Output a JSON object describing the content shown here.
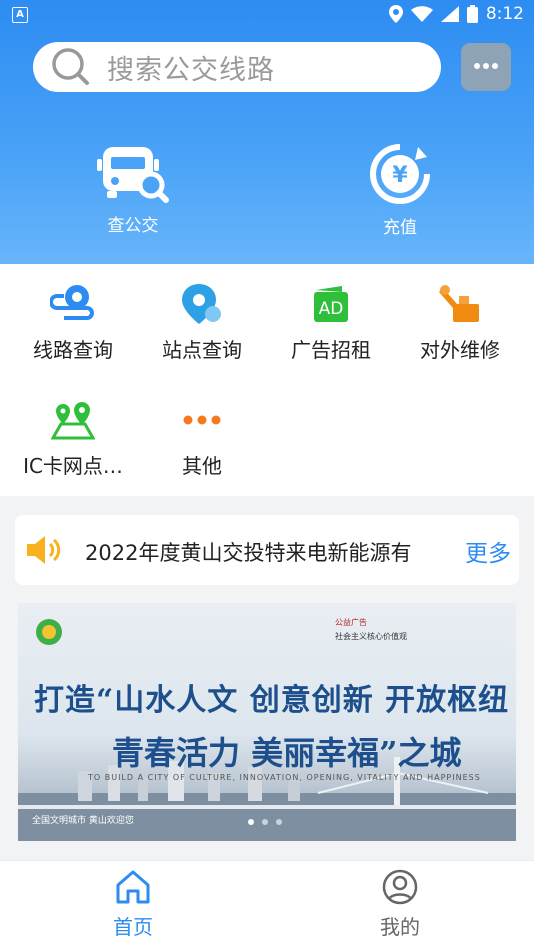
{
  "status_bar": {
    "sim_label": "A",
    "time": "8:12",
    "icons": [
      "location-icon",
      "wifi-icon",
      "signal-icon",
      "battery-icon"
    ]
  },
  "search": {
    "placeholder": "搜索公交线路",
    "icon": "search-icon"
  },
  "header_actions": {
    "message_icon": "chat-bubble-icon"
  },
  "quick_actions": [
    {
      "label": "查公交",
      "icon": "bus-search-icon"
    },
    {
      "label": "充值",
      "icon": "recharge-yen-icon"
    }
  ],
  "services": [
    {
      "label": "线路查询",
      "icon": "route-icon",
      "color": "#2d8cf2"
    },
    {
      "label": "站点查询",
      "icon": "station-pin-icon",
      "color": "#2da0e6"
    },
    {
      "label": "广告招租",
      "icon": "ad-icon",
      "color": "#2fbf3a"
    },
    {
      "label": "对外维修",
      "icon": "repair-icon",
      "color": "#f08a10"
    },
    {
      "label": "IC卡网点…",
      "icon": "map-pins-icon",
      "color": "#2fbf3a"
    },
    {
      "label": "其他",
      "icon": "more-dots-icon",
      "color": "#f57a1f"
    }
  ],
  "notice": {
    "icon": "speaker-icon",
    "text": "2022年度黄山交投特来电新能源有",
    "more_label": "更多"
  },
  "banner": {
    "line1": "打造“山水人文 创意创新 开放枢纽",
    "line2": "青春活力 美丽幸福”之城",
    "subtitle": "TO BUILD A CITY OF CULTURE, INNOVATION, OPENING, VITALITY AND HAPPINESS",
    "footer": "全国文明城市 黄山欢迎您",
    "side_text": "公益广告",
    "side_text2": "社会主义核心价值观",
    "page_count": 3,
    "active_page": 1
  },
  "tab_bar": {
    "tabs": [
      {
        "label": "首页",
        "icon": "home-icon",
        "active": true
      },
      {
        "label": "我的",
        "icon": "profile-icon",
        "active": false
      }
    ]
  },
  "colors": {
    "brand": "#2d8cf2",
    "active_tab": "#2d8cf2",
    "inactive_tab": "#666666"
  }
}
